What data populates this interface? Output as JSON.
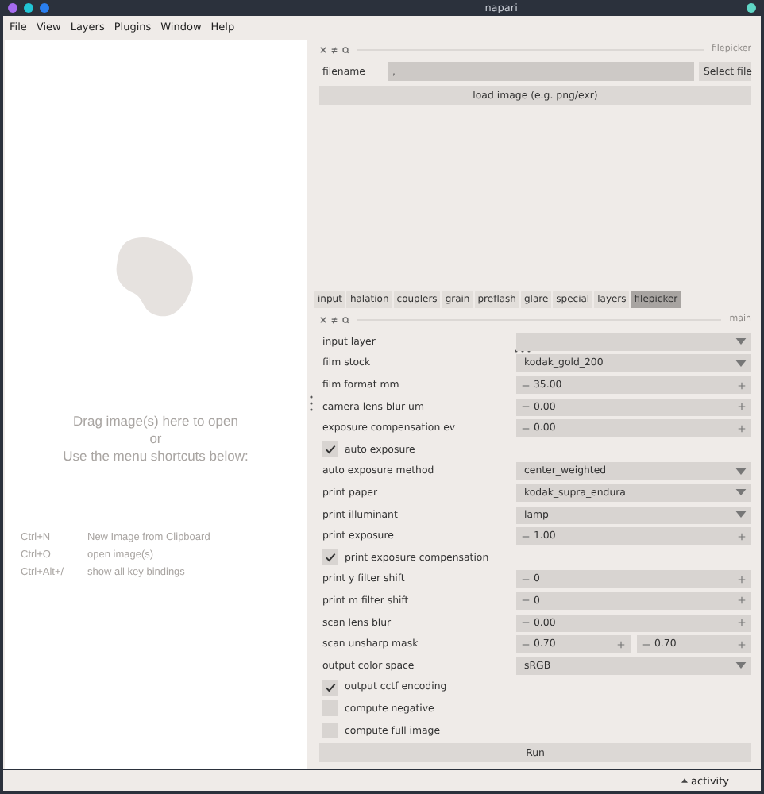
{
  "window": {
    "title": "napari"
  },
  "menu": [
    {
      "label": "File"
    },
    {
      "label": "View"
    },
    {
      "label": "Layers"
    },
    {
      "label": "Plugins"
    },
    {
      "label": "Window"
    },
    {
      "label": "Help"
    }
  ],
  "canvas": {
    "drop_hint": [
      "Drag image(s) here to open",
      "or",
      "Use the menu shortcuts below:"
    ],
    "shortcuts": [
      {
        "keys": "Ctrl+N",
        "action": "New Image from Clipboard"
      },
      {
        "keys": "Ctrl+O",
        "action": "open image(s)"
      },
      {
        "keys": "Ctrl+Alt+/",
        "action": "show all key bindings"
      }
    ]
  },
  "filepicker_dock": {
    "title": "filepicker",
    "filename_label": "filename",
    "filename_value": ",",
    "select_button": "Select file",
    "load_button": "load image (e.g. png/exr)"
  },
  "tabs": [
    {
      "label": "input",
      "selected": false
    },
    {
      "label": "halation",
      "selected": false
    },
    {
      "label": "couplers",
      "selected": false
    },
    {
      "label": "grain",
      "selected": false
    },
    {
      "label": "preflash",
      "selected": false
    },
    {
      "label": "glare",
      "selected": false
    },
    {
      "label": "special",
      "selected": false
    },
    {
      "label": "layers",
      "selected": false
    },
    {
      "label": "filepicker",
      "selected": true
    }
  ],
  "main_dock": {
    "title": "main",
    "rows": [
      {
        "kind": "select",
        "label": "input layer"
      },
      {
        "kind": "select",
        "label": "film stock",
        "value": "kodak_gold_200"
      },
      {
        "kind": "spin",
        "label": "film format mm",
        "value": "35.00"
      },
      {
        "kind": "spin",
        "label": "camera lens blur um",
        "value": "0.00"
      },
      {
        "kind": "spin",
        "label": "exposure compensation ev",
        "value": "0.00"
      },
      {
        "kind": "check",
        "label": "auto exposure",
        "checked": true
      },
      {
        "kind": "select",
        "label": "auto exposure method",
        "value": "center_weighted"
      },
      {
        "kind": "select",
        "label": "print paper",
        "value": "kodak_supra_endura"
      },
      {
        "kind": "select",
        "label": "print illuminant",
        "value": "lamp"
      },
      {
        "kind": "spin",
        "label": "print exposure",
        "value": "1.00"
      },
      {
        "kind": "check",
        "label": "print exposure compensation",
        "checked": true
      },
      {
        "kind": "spin",
        "label": "print y filter shift",
        "value": "0"
      },
      {
        "kind": "spin",
        "label": "print m filter shift",
        "value": "0"
      },
      {
        "kind": "spin",
        "label": "scan lens blur",
        "value": "0.00"
      },
      {
        "kind": "spin2",
        "label": "scan unsharp mask",
        "values": [
          "0.70",
          "0.70"
        ]
      },
      {
        "kind": "select",
        "label": "output color space",
        "value": "sRGB"
      },
      {
        "kind": "check",
        "label": "output cctf encoding",
        "checked": true
      },
      {
        "kind": "check",
        "label": "compute negative",
        "checked": false
      },
      {
        "kind": "check",
        "label": "compute full image",
        "checked": false
      }
    ],
    "run_button": "Run"
  },
  "status_bar": {
    "activity": "activity"
  }
}
